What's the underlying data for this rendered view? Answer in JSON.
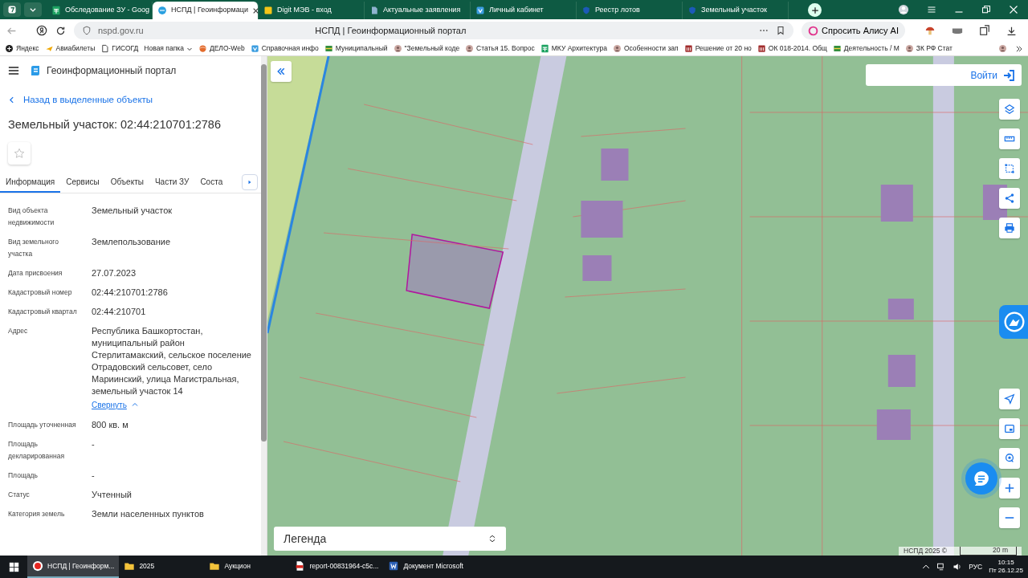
{
  "browser": {
    "tabs": [
      {
        "label": "Обследование ЗУ - Goog",
        "kind": "sheets",
        "selected": false
      },
      {
        "label": "НСПД | Геоинформаци",
        "kind": "portal",
        "selected": true
      },
      {
        "label": "Digit МЭВ - вход",
        "kind": "square",
        "selected": false
      },
      {
        "label": "Актуальные заявления",
        "kind": "doc",
        "selected": false
      },
      {
        "label": "Личный кабинет",
        "kind": "gosuslugi",
        "selected": false
      },
      {
        "label": "Реестр лотов",
        "kind": "shield",
        "selected": false
      },
      {
        "label": "Земельный участок",
        "kind": "shield",
        "selected": false
      }
    ],
    "url": "nspd.gov.ru",
    "page_title": "НСПД | Геоинформационный портал",
    "alice_button": "Спросить Алису AI",
    "bookmarks": [
      {
        "label": "Яндекс",
        "kind": "yandex"
      },
      {
        "label": "Авиабилеты",
        "kind": "plane"
      },
      {
        "label": "ГИСОГД",
        "kind": "page"
      },
      {
        "label": "Новая папка",
        "kind": "folder"
      },
      {
        "label": "ДЕЛО-Web",
        "kind": "globe"
      },
      {
        "label": "Справочная инфо",
        "kind": "gosuslugi"
      },
      {
        "label": "Муниципальный",
        "kind": "flag"
      },
      {
        "label": "\"Земельный коде",
        "kind": "person"
      },
      {
        "label": "Статья 15. Вопрос",
        "kind": "person"
      },
      {
        "label": "МКУ Архитектура",
        "kind": "sheets"
      },
      {
        "label": "Особенности зап",
        "kind": "person"
      },
      {
        "label": "Решение от 20 но",
        "kind": "building"
      },
      {
        "label": "ОК 018-2014. Общ",
        "kind": "building"
      },
      {
        "label": "Деятельность / М",
        "kind": "flag"
      },
      {
        "label": "ЗК РФ Стат",
        "kind": "person"
      }
    ]
  },
  "portal": {
    "title": "Геоинформационный портал",
    "back_link": "Назад в выделенные объекты",
    "heading": "Земельный участок: 02:44:210701:2786",
    "starred": false,
    "tabs": [
      {
        "label": "Информация",
        "selected": true
      },
      {
        "label": "Сервисы",
        "selected": false
      },
      {
        "label": "Объекты",
        "selected": false
      },
      {
        "label": "Части ЗУ",
        "selected": false
      },
      {
        "label": "Соста",
        "selected": false
      }
    ],
    "properties": [
      {
        "label": "Вид объекта недвижимости",
        "value": "Земельный участок"
      },
      {
        "label": "Вид земельного участка",
        "value": "Землепользование"
      },
      {
        "label": "Дата присвоения",
        "value": "27.07.2023"
      },
      {
        "label": "Кадастровый номер",
        "value": "02:44:210701:2786"
      },
      {
        "label": "Кадастровый квартал",
        "value": "02:44:210701"
      },
      {
        "label": "Адрес",
        "value": "Республика Башкортостан, муниципальный район Стерлитамакский, сельское поселение Отрадовский сельсовет, село Мариинский, улица Магистральная, земельный участок 14",
        "action": "Свернуть"
      },
      {
        "label": "Площадь уточненная",
        "value": "800 кв. м"
      },
      {
        "label": "Площадь декларированная",
        "value": "-"
      },
      {
        "label": "Площадь",
        "value": "-"
      },
      {
        "label": "Статус",
        "value": "Учтенный"
      },
      {
        "label": "Категория земель",
        "value": "Земли населенных пунктов"
      }
    ]
  },
  "map": {
    "login": "Войти",
    "legend": "Легенда",
    "attribution": "НСПД 2025 ©",
    "scale": "20 m",
    "tools": [
      {
        "kind": "layers"
      },
      {
        "kind": "ruler"
      },
      {
        "kind": "select"
      },
      {
        "kind": "share"
      },
      {
        "kind": "print"
      }
    ],
    "bottom_tools": [
      {
        "kind": "navigate"
      },
      {
        "kind": "window"
      },
      {
        "kind": "locate"
      },
      {
        "kind": "plus"
      },
      {
        "kind": "minus"
      }
    ]
  },
  "taskbar": {
    "items": [
      {
        "label": "НСПД | Геоинформ...",
        "kind": "yabrowser",
        "selected": true
      },
      {
        "label": "2025",
        "kind": "folder",
        "selected": false
      },
      {
        "label": "Аукцион",
        "kind": "folder",
        "selected": false
      },
      {
        "label": "report-00831964-c5c...",
        "kind": "pdf",
        "selected": false
      },
      {
        "label": "Документ Microsoft",
        "kind": "word",
        "selected": false
      }
    ],
    "language": "РУС",
    "time": "10:15",
    "date": "Пт 26.12.25"
  }
}
